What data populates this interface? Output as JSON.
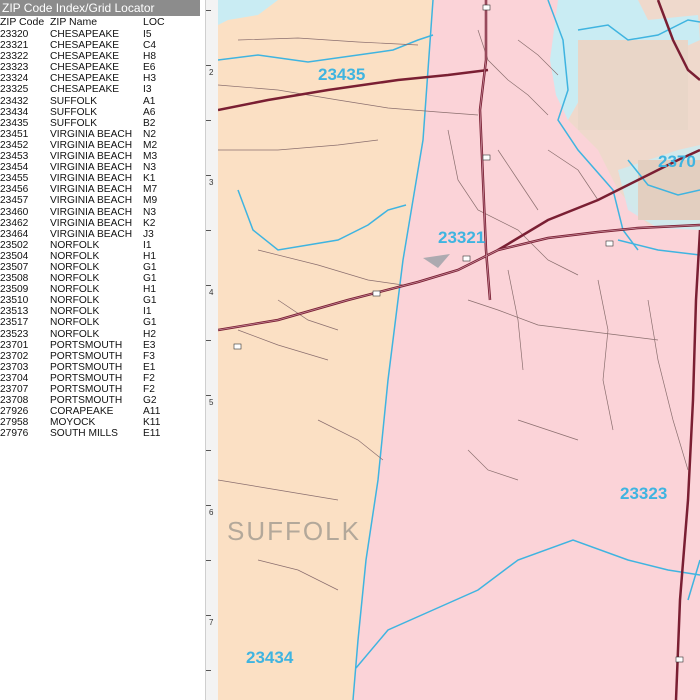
{
  "index": {
    "title": "ZIP Code Index/Grid Locator",
    "col_zip": "ZIP Code",
    "col_name": "ZIP Name",
    "col_loc": "LOC",
    "rows": [
      {
        "zip": "23320",
        "name": "CHESAPEAKE",
        "loc": "I5"
      },
      {
        "zip": "23321",
        "name": "CHESAPEAKE",
        "loc": "C4"
      },
      {
        "zip": "23322",
        "name": "CHESAPEAKE",
        "loc": "H8"
      },
      {
        "zip": "23323",
        "name": "CHESAPEAKE",
        "loc": "E6"
      },
      {
        "zip": "23324",
        "name": "CHESAPEAKE",
        "loc": "H3"
      },
      {
        "zip": "23325",
        "name": "CHESAPEAKE",
        "loc": "I3"
      },
      {
        "zip": "23432",
        "name": "SUFFOLK",
        "loc": "A1"
      },
      {
        "zip": "23434",
        "name": "SUFFOLK",
        "loc": "A6"
      },
      {
        "zip": "23435",
        "name": "SUFFOLK",
        "loc": "B2"
      },
      {
        "zip": "23451",
        "name": "VIRGINIA BEACH",
        "loc": "N2"
      },
      {
        "zip": "23452",
        "name": "VIRGINIA BEACH",
        "loc": "M2"
      },
      {
        "zip": "23453",
        "name": "VIRGINIA BEACH",
        "loc": "M3"
      },
      {
        "zip": "23454",
        "name": "VIRGINIA BEACH",
        "loc": "N3"
      },
      {
        "zip": "23455",
        "name": "VIRGINIA BEACH",
        "loc": "K1"
      },
      {
        "zip": "23456",
        "name": "VIRGINIA BEACH",
        "loc": "M7"
      },
      {
        "zip": "23457",
        "name": "VIRGINIA BEACH",
        "loc": "M9"
      },
      {
        "zip": "23460",
        "name": "VIRGINIA BEACH",
        "loc": "N3"
      },
      {
        "zip": "23462",
        "name": "VIRGINIA BEACH",
        "loc": "K2"
      },
      {
        "zip": "23464",
        "name": "VIRGINIA BEACH",
        "loc": "J3"
      },
      {
        "zip": "23502",
        "name": "NORFOLK",
        "loc": "I1"
      },
      {
        "zip": "23504",
        "name": "NORFOLK",
        "loc": "H1"
      },
      {
        "zip": "23507",
        "name": "NORFOLK",
        "loc": "G1"
      },
      {
        "zip": "23508",
        "name": "NORFOLK",
        "loc": "G1"
      },
      {
        "zip": "23509",
        "name": "NORFOLK",
        "loc": "H1"
      },
      {
        "zip": "23510",
        "name": "NORFOLK",
        "loc": "G1"
      },
      {
        "zip": "23513",
        "name": "NORFOLK",
        "loc": "I1"
      },
      {
        "zip": "23517",
        "name": "NORFOLK",
        "loc": "G1"
      },
      {
        "zip": "23523",
        "name": "NORFOLK",
        "loc": "H2"
      },
      {
        "zip": "23701",
        "name": "PORTSMOUTH",
        "loc": "E3"
      },
      {
        "zip": "23702",
        "name": "PORTSMOUTH",
        "loc": "F3"
      },
      {
        "zip": "23703",
        "name": "PORTSMOUTH",
        "loc": "E1"
      },
      {
        "zip": "23704",
        "name": "PORTSMOUTH",
        "loc": "F2"
      },
      {
        "zip": "23707",
        "name": "PORTSMOUTH",
        "loc": "F2"
      },
      {
        "zip": "23708",
        "name": "PORTSMOUTH",
        "loc": "G2"
      },
      {
        "zip": "27926",
        "name": "CORAPEAKE",
        "loc": "A11"
      },
      {
        "zip": "27958",
        "name": "MOYOCK",
        "loc": "K11"
      },
      {
        "zip": "27976",
        "name": "SOUTH MILLS",
        "loc": "E11"
      }
    ]
  },
  "ruler": {
    "numbers": [
      "2",
      "3",
      "4",
      "5",
      "6",
      "7"
    ]
  },
  "map": {
    "zip_labels": {
      "z23435": "23435",
      "z23321": "23321",
      "z23323": "23323",
      "z23434": "23434",
      "z2370x": "2370"
    },
    "city_label": "SUFFOLK",
    "colors": {
      "suffolk_fill": "#fbe0c4",
      "chesapeake_fill": "#fbd3d8",
      "norfolk_fill": "#f2e4d8",
      "water": "#c9ecf3",
      "zip_boundary": "#3fb4e0",
      "highway": "#7a1f33"
    }
  }
}
